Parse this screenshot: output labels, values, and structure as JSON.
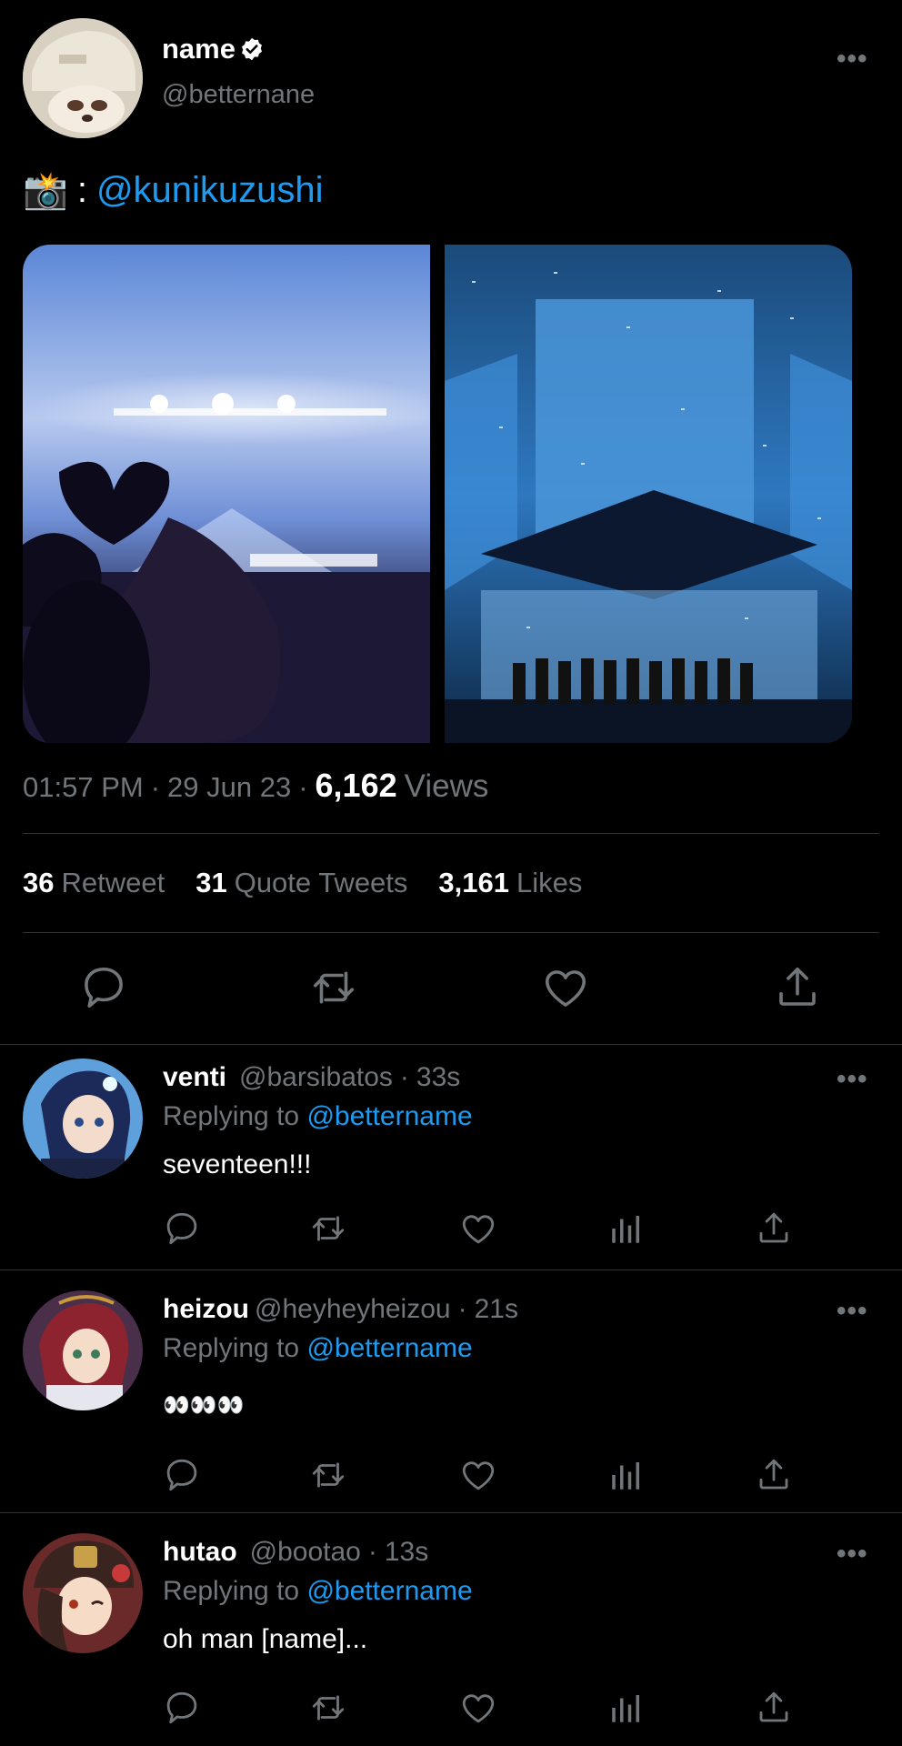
{
  "tweet": {
    "author_name": "name",
    "author_handle": "@betternane",
    "camera_emoji": "📸",
    "text_prefix": ":",
    "mention": "@kunikuzushi",
    "time": "01:57 PM",
    "date": "29 Jun 23",
    "views_count": "6,162",
    "views_label": "Views",
    "separator": "·",
    "stats": {
      "retweet_count": "36",
      "retweet_label": "Retweet",
      "quote_count": "31",
      "quote_label": "Quote Tweets",
      "likes_count": "3,161",
      "likes_label": "Likes"
    }
  },
  "replies": [
    {
      "name": "venti",
      "handle": "@barsibatos",
      "time": "33s",
      "replying_label": "Replying to",
      "replying_to": "@bettername",
      "text": "seventeen!!!"
    },
    {
      "name": "heizou",
      "handle": "@heyheyheizou",
      "time": "21s",
      "replying_label": "Replying to",
      "replying_to": "@bettername",
      "text": "👀👀👀"
    },
    {
      "name": "hutao",
      "handle": "@bootao",
      "time": "13s",
      "replying_label": "Replying to",
      "replying_to": "@bettername",
      "text": "oh man [name]..."
    }
  ],
  "icons": {
    "verified": "verified-badge-icon",
    "more": "more-options-icon",
    "reply": "reply-icon",
    "retweet": "retweet-icon",
    "like": "heart-icon",
    "analytics": "analytics-icon",
    "share": "share-icon"
  },
  "colors": {
    "background": "#000000",
    "text_primary": "#e7e9ea",
    "text_secondary": "#71767b",
    "accent": "#1d9bf0",
    "divider": "#2f3336"
  }
}
